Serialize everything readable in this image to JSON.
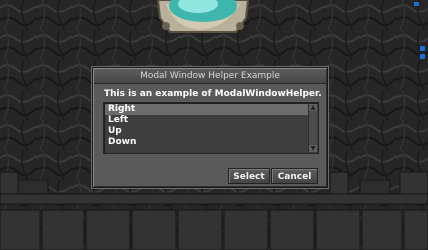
{
  "dialog": {
    "title": "Modal Window Helper Example",
    "message": "This is an example of ModalWindowHelper.",
    "options": [
      "Right",
      "Left",
      "Up",
      "Down"
    ],
    "selected_option": "Right",
    "select_label": "Select",
    "cancel_label": "Cancel"
  },
  "scroll_icons": {
    "up": "scroll-up-arrow-icon",
    "down": "scroll-down-arrow-icon"
  },
  "colors": {
    "dialog_bg": "#5a5a5a",
    "list_bg": "#3e3e3e",
    "selected_row": "#6c6c6c",
    "text": "#ffffff",
    "title_text": "#d8d8d8",
    "orb": "#40c8c0",
    "wall": "#2a2a2a"
  }
}
